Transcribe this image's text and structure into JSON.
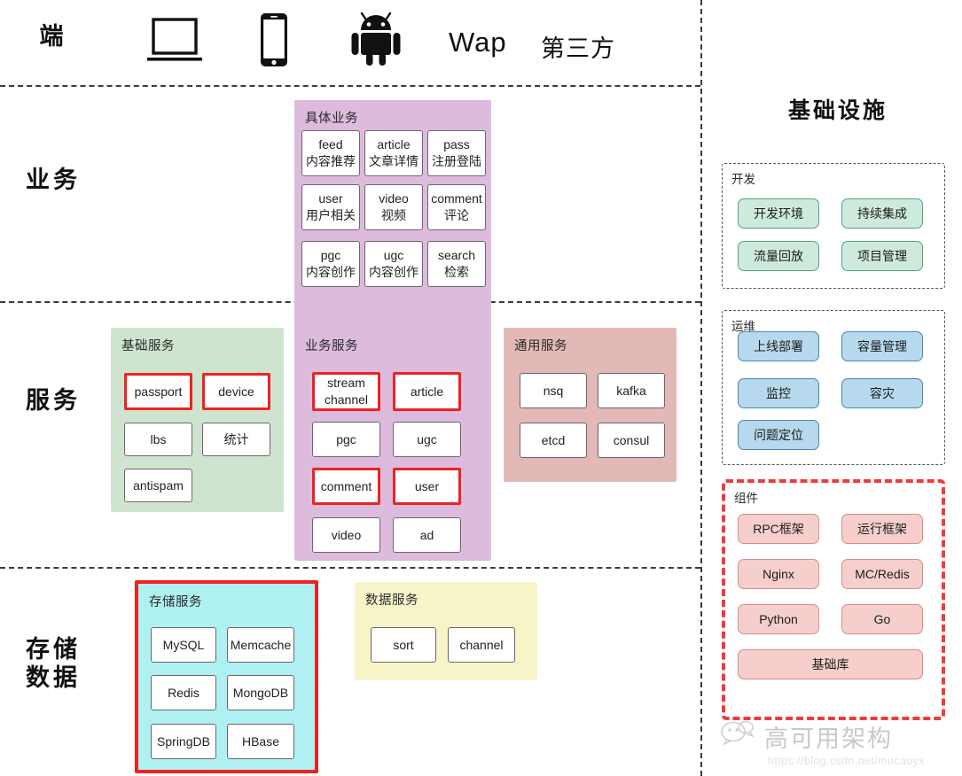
{
  "rows": {
    "client": {
      "label": "端"
    },
    "business": {
      "label": "业务"
    },
    "service": {
      "label": "服务"
    },
    "storage": {
      "label": "存储\n数据"
    }
  },
  "clients": {
    "laptop_icon": "laptop-icon",
    "phone_icon": "iphone-icon",
    "android_icon": "android-icon",
    "wap": "Wap",
    "third_party": "第三方"
  },
  "business_panel": {
    "title": "具体业务",
    "nodes": [
      {
        "name": "feed",
        "sub": "内容推荐"
      },
      {
        "name": "article",
        "sub": "文章详情"
      },
      {
        "name": "pass",
        "sub": "注册登陆"
      },
      {
        "name": "user",
        "sub": "用户相关"
      },
      {
        "name": "video",
        "sub": "视频"
      },
      {
        "name": "comment",
        "sub": "评论"
      },
      {
        "name": "pgc",
        "sub": "内容创作"
      },
      {
        "name": "ugc",
        "sub": "内容创作"
      },
      {
        "name": "search",
        "sub": "检索"
      }
    ]
  },
  "base_service_panel": {
    "title": "基础服务",
    "nodes": [
      {
        "name": "passport",
        "highlight": true
      },
      {
        "name": "device",
        "highlight": true
      },
      {
        "name": "lbs",
        "highlight": false
      },
      {
        "name": "统计",
        "highlight": false
      },
      {
        "name": "antispam",
        "highlight": false
      }
    ]
  },
  "biz_service_panel": {
    "title": "业务服务",
    "nodes": [
      {
        "name": "stream",
        "sub": "channel",
        "highlight": true
      },
      {
        "name": "article",
        "sub": "",
        "highlight": true
      },
      {
        "name": "pgc",
        "sub": "",
        "highlight": false
      },
      {
        "name": "ugc",
        "sub": "",
        "highlight": false
      },
      {
        "name": "comment",
        "sub": "",
        "highlight": true
      },
      {
        "name": "user",
        "sub": "",
        "highlight": true
      },
      {
        "name": "video",
        "sub": "",
        "highlight": false
      },
      {
        "name": "ad",
        "sub": "",
        "highlight": false
      }
    ]
  },
  "common_service_panel": {
    "title": "通用服务",
    "nodes": [
      {
        "name": "nsq"
      },
      {
        "name": "kafka"
      },
      {
        "name": "etcd"
      },
      {
        "name": "consul"
      }
    ]
  },
  "storage_panel": {
    "title": "存储服务",
    "nodes": [
      {
        "name": "MySQL"
      },
      {
        "name": "Memcache"
      },
      {
        "name": "Redis"
      },
      {
        "name": "MongoDB"
      },
      {
        "name": "SpringDB"
      },
      {
        "name": "HBase"
      }
    ]
  },
  "data_panel": {
    "title": "数据服务",
    "nodes": [
      {
        "name": "sort"
      },
      {
        "name": "channel"
      }
    ]
  },
  "infrastructure": {
    "title": "基础设施",
    "groups": [
      {
        "title": "开发",
        "style": "green",
        "chips": [
          "开发环境",
          "持续集成",
          "流量回放",
          "项目管理"
        ]
      },
      {
        "title": "运维",
        "style": "blue",
        "chips": [
          "上线部署",
          "容量管理",
          "监控",
          "容灾",
          "问题定位"
        ]
      },
      {
        "title": "组件",
        "style": "red",
        "chips": [
          "RPC框架",
          "运行框架",
          "Nginx",
          "MC/Redis",
          "Python",
          "Go",
          "基础库"
        ]
      }
    ]
  },
  "watermark": {
    "logo_icon": "wechat-icon",
    "text": "高可用架构",
    "url": "https://blog.csdn.net/mucaoyx"
  },
  "colors": {
    "purple": "#dcbbdd",
    "green": "#cfe4cf",
    "pink": "#e2b9b6",
    "cyan": "#aff1f2",
    "yellow": "#f7f5c8",
    "highlight_red": "#ee2222",
    "chip_green": "#cdeadd",
    "chip_blue": "#b6d9ee",
    "chip_red": "#f6cfcc"
  }
}
